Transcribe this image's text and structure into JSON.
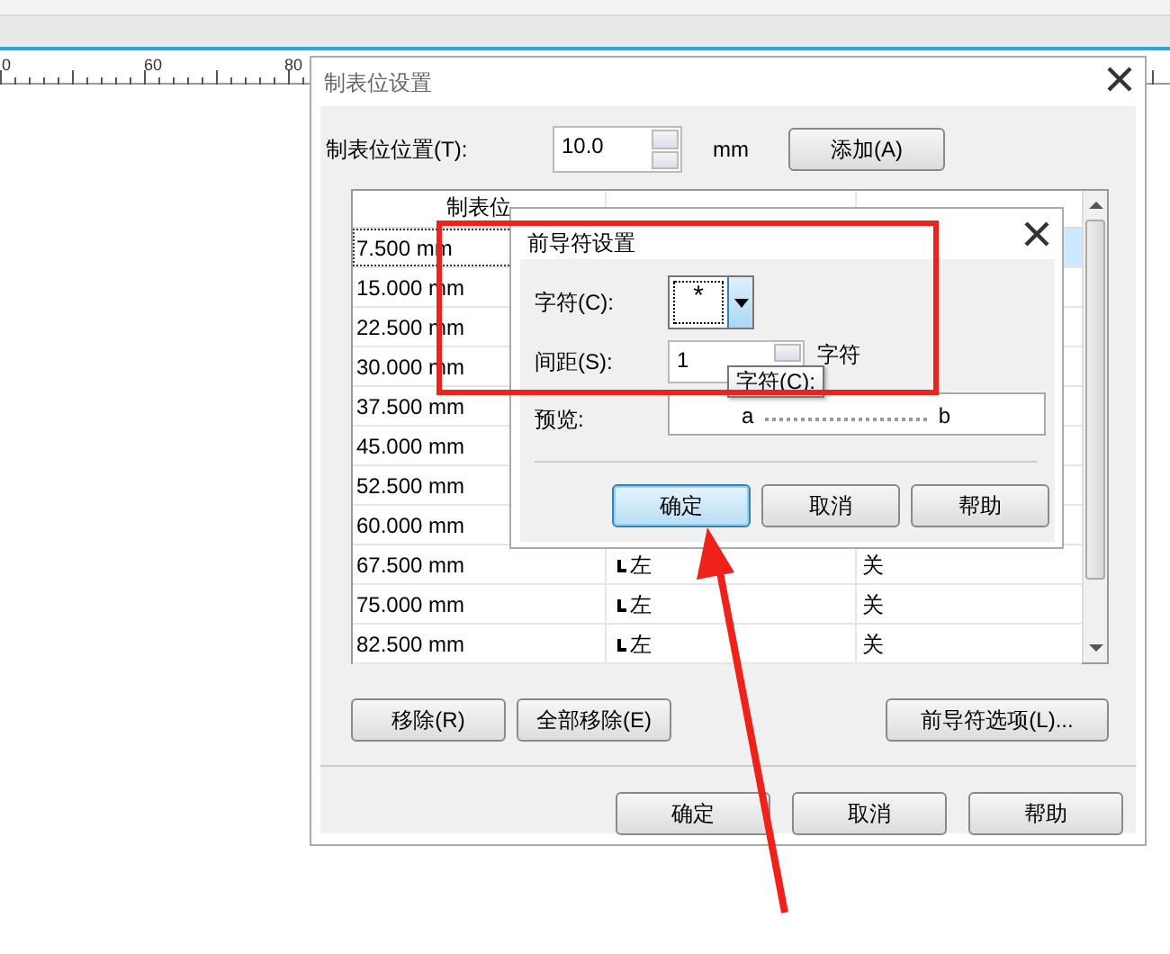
{
  "ruler": {
    "labels": [
      "0",
      "60",
      "80"
    ]
  },
  "dialog": {
    "title": "制表位设置",
    "position_label": "制表位位置(T):",
    "position_value": "10.0",
    "unit": "mm",
    "add_button": "添加(A)",
    "columns": [
      "制表位"
    ],
    "rows": [
      {
        "tab": "7.500 mm",
        "selected": true
      },
      {
        "tab": "15.000 mm",
        "selected": false
      },
      {
        "tab": "22.500 mm",
        "selected": false
      },
      {
        "tab": "30.000 mm",
        "selected": false
      },
      {
        "tab": "37.500 mm",
        "selected": false
      },
      {
        "tab": "45.000 mm",
        "selected": false
      },
      {
        "tab": "52.500 mm",
        "selected": false
      },
      {
        "tab": "60.000 mm",
        "selected": false
      },
      {
        "tab": "67.500 mm",
        "alignment": "左",
        "leader": "关",
        "selected": false
      },
      {
        "tab": "75.000 mm",
        "alignment": "左",
        "leader": "关",
        "selected": false
      },
      {
        "tab": "82.500 mm",
        "alignment": "左",
        "leader": "关",
        "selected": false
      }
    ],
    "list_buttons": [
      "移除(R)",
      "全部移除(E)",
      "前导符选项(L)..."
    ],
    "footer_buttons": [
      "确定",
      "取消",
      "帮助"
    ]
  },
  "leader_dialog": {
    "title": "前导符设置",
    "character_label": "字符(C):",
    "character_value": "*",
    "spacing_label": "间距(S):",
    "spacing_value": "1",
    "spacing_unit": "字符",
    "preview_label": "预览:",
    "preview_start": "a",
    "preview_end": "b",
    "buttons": [
      {
        "label": "确定",
        "default": true
      },
      {
        "label": "取消",
        "default": false
      },
      {
        "label": "帮助",
        "default": false
      }
    ]
  },
  "tooltip": "字符(C):",
  "annotations": {
    "box": true,
    "arrow": true
  }
}
